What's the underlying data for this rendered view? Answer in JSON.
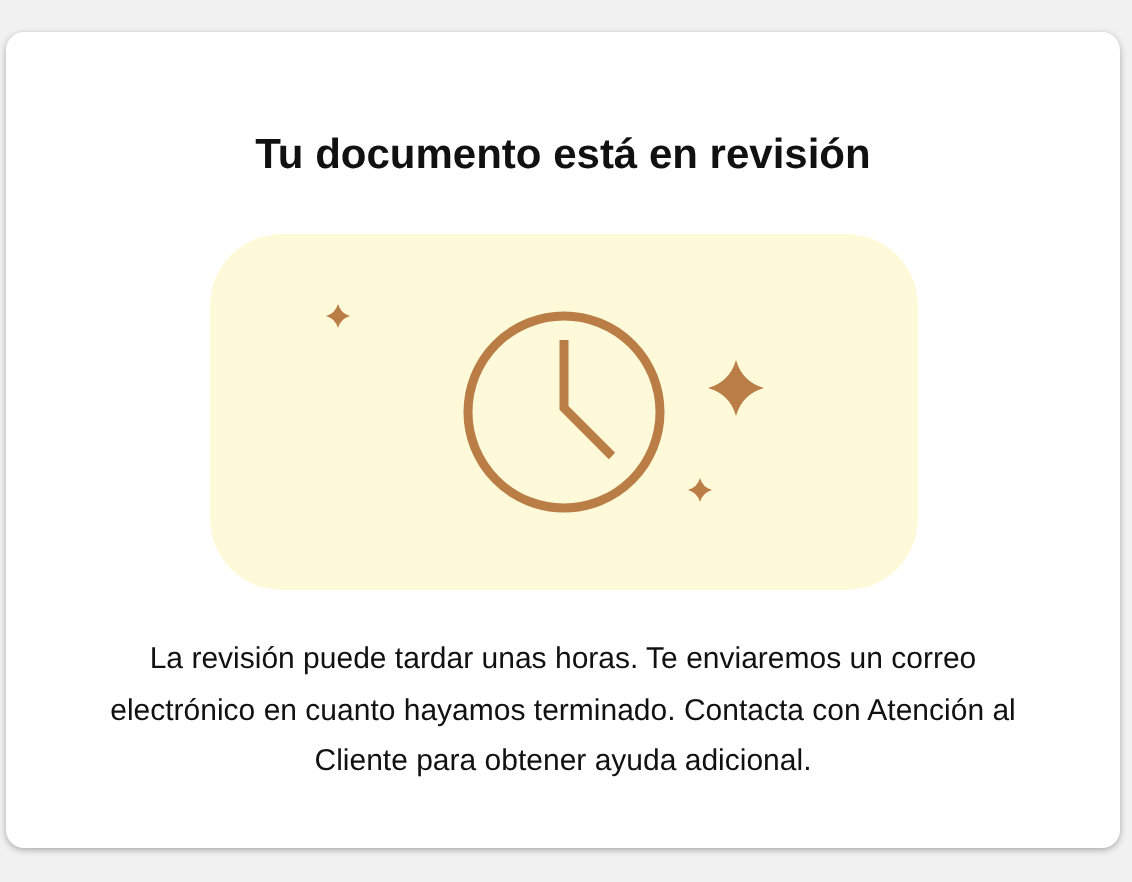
{
  "card": {
    "title": "Tu documento está en revisión",
    "message": "La revisión puede tardar unas horas. Te enviaremos un correo electrónico en cuanto hayamos terminado. Contacta con Atención al Cliente para obtener ayuda adicional."
  }
}
